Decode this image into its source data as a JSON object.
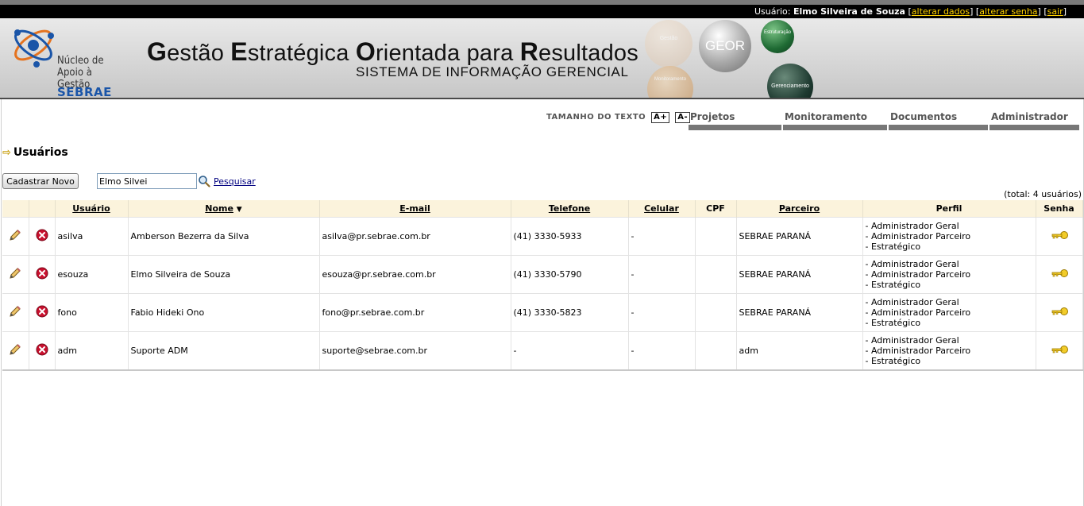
{
  "userbar": {
    "prefix": "Usuário:",
    "name": "Elmo Silveira de Souza",
    "links": [
      "alterar dados",
      "alterar senha",
      "sair"
    ]
  },
  "banner": {
    "logo_line1": "Núcleo de",
    "logo_line2": "Apoio à Gestão",
    "logo_brand": "SEBRAE",
    "headline_words": [
      {
        "cap": "G",
        "rest": "estão "
      },
      {
        "cap": "E",
        "rest": "stratégica "
      },
      {
        "cap": "O",
        "rest": "rientada para "
      },
      {
        "cap": "R",
        "rest": "esultados"
      }
    ],
    "subtitle": "SISTEMA DE INFORMAÇÃO GERENCIAL",
    "spheres": {
      "main": "GEOR",
      "top": "Estruturação",
      "bottom": "Gerenciamento",
      "faded_top": "Gestão",
      "faded_bottom": "Monitoramento"
    }
  },
  "text_size": {
    "label": "TAMANHO DO TEXTO",
    "increase": "A+",
    "decrease": "A-"
  },
  "nav": [
    "Projetos",
    "Monitoramento",
    "Documentos",
    "Administrador"
  ],
  "page_title": "Usuários",
  "toolbar": {
    "new_button": "Cadastrar Novo",
    "search_value": "Elmo Silvei",
    "search_link": "Pesquisar"
  },
  "total": "(total: 4 usuários)",
  "table": {
    "headers": {
      "usuario": "Usuário",
      "nome": "Nome",
      "email": "E-mail",
      "telefone": "Telefone",
      "celular": "Celular",
      "cpf": "CPF",
      "parceiro": "Parceiro",
      "perfil": "Perfil",
      "senha": "Senha"
    },
    "rows": [
      {
        "usuario": "asilva",
        "nome": "Amberson Bezerra da Silva",
        "email": "asilva@pr.sebrae.com.br",
        "telefone": "(41) 3330-5933",
        "celular": "-",
        "cpf": "",
        "parceiro": "SEBRAE PARANÁ",
        "perfil": [
          "- Administrador Geral",
          "- Administrador Parceiro",
          "- Estratégico"
        ]
      },
      {
        "usuario": "esouza",
        "nome": "Elmo Silveira de Souza",
        "email": "esouza@pr.sebrae.com.br",
        "telefone": "(41) 3330-5790",
        "celular": "-",
        "cpf": "",
        "parceiro": "SEBRAE PARANÁ",
        "perfil": [
          "- Administrador Geral",
          "- Administrador Parceiro",
          "- Estratégico"
        ]
      },
      {
        "usuario": "fono",
        "nome": "Fabio Hideki Ono",
        "email": "fono@pr.sebrae.com.br",
        "telefone": "(41) 3330-5823",
        "celular": "-",
        "cpf": "",
        "parceiro": "SEBRAE PARANÁ",
        "perfil": [
          "- Administrador Geral",
          "- Administrador Parceiro",
          "- Estratégico"
        ]
      },
      {
        "usuario": "adm",
        "nome": "Suporte ADM",
        "email": "suporte@sebrae.com.br",
        "telefone": "-",
        "celular": "-",
        "cpf": "",
        "parceiro": "adm",
        "perfil": [
          "- Administrador Geral",
          "- Administrador Parceiro",
          "- Estratégico"
        ]
      }
    ]
  },
  "colors": {
    "accent_link": "#ffd200",
    "header_bg": "#fbf3dc",
    "delete_icon": "#c8102e",
    "key_icon": "#e6b800"
  }
}
